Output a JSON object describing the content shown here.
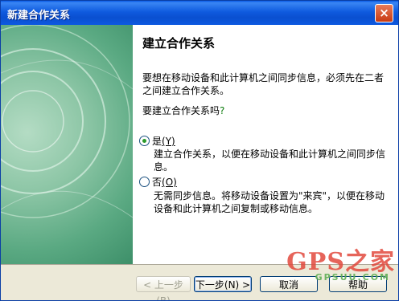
{
  "window": {
    "title": "新建合作关系",
    "close_label": "×"
  },
  "content": {
    "heading": "建立合作关系",
    "description": "要想在移动设备和此计算机之间同步信息，必须先在二者之间建立合作关系。",
    "question_text": "要建立合作关系吗",
    "question_mark": "?",
    "options": [
      {
        "label": "是",
        "accel": "(Y)",
        "selected": true,
        "description": "建立合作关系，以便在移动设备和此计算机之间同步信息。"
      },
      {
        "label": "否",
        "accel": "(O)",
        "selected": false,
        "description": "无需同步信息。将移动设备设置为\"来宾\"，以便在移动设备和此计算机之间复制或移动信息。"
      }
    ]
  },
  "footer": {
    "back_label": "< 上一步(B)",
    "next_label": "下一步(N) >",
    "cancel_label": "取消",
    "help_label": "帮助"
  },
  "watermark": {
    "brand": "GPS之家",
    "site": "GPSUU.COM"
  },
  "colors": {
    "title_bar": "#0a4fd0",
    "left_art": "#5aa982",
    "watermark": "#e24a3e"
  }
}
